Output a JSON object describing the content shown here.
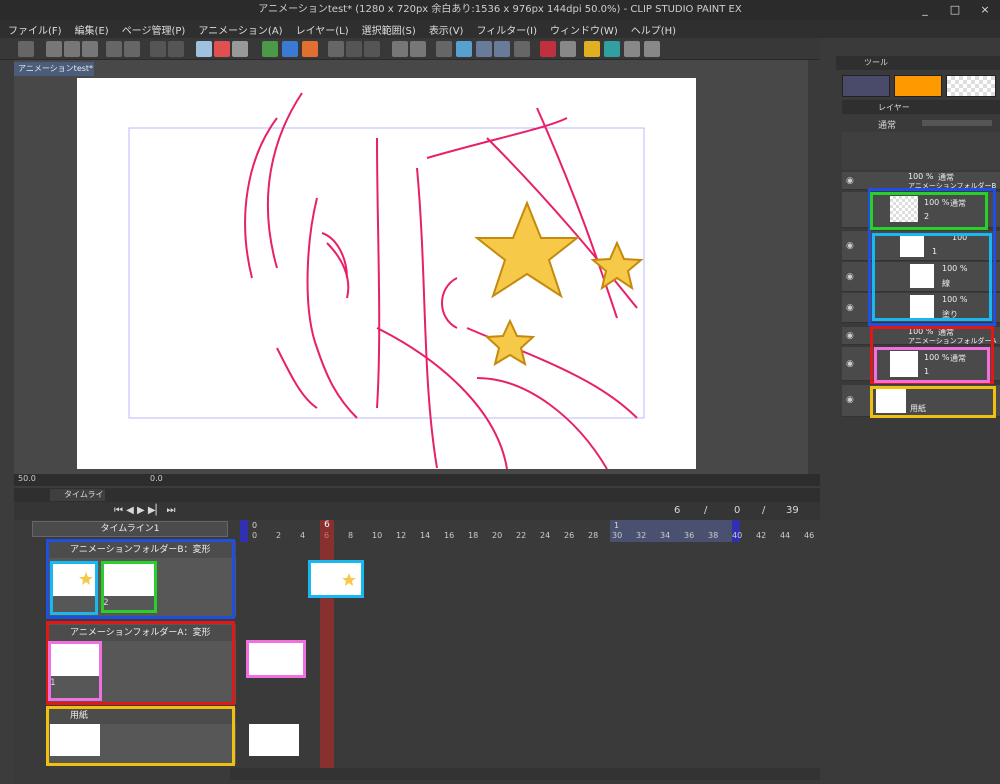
{
  "window": {
    "title": "アニメーションtest* (1280 x 720px 余白あり:1536 x 976px 144dpi 50.0%) - CLIP STUDIO PAINT EX",
    "controls": [
      "_",
      "□",
      "×"
    ]
  },
  "menu": [
    "ファイル(F)",
    "編集(E)",
    "ページ管理(P)",
    "アニメーション(A)",
    "レイヤー(L)",
    "選択範囲(S)",
    "表示(V)",
    "フィルター(I)",
    "ウィンドウ(W)",
    "ヘルプ(H)"
  ],
  "canvas": {
    "tab_label": "アニメーションtest*",
    "zoom": "50.0",
    "angle": "0.0"
  },
  "timeline": {
    "panel_tab": "タイムライン",
    "select_value": "タイムライン1",
    "frame_current": "6",
    "frame_sep1": "/",
    "frame_zero": "0",
    "frame_sep2": "/",
    "frame_total": "39",
    "ruler_labels": [
      "0",
      "2",
      "4",
      "6",
      "8",
      "10",
      "12",
      "14",
      "16",
      "18",
      "20",
      "22",
      "24",
      "26",
      "28",
      "30",
      "32",
      "34",
      "36",
      "38",
      "40",
      "42",
      "44",
      "46"
    ],
    "ruler_top_left": "0",
    "ruler_top_mid": "1",
    "playhead_label": "6",
    "tracks": [
      {
        "name": "アニメーションフォルダーB：変形",
        "cel_label": "2"
      },
      {
        "name": "アニメーションフォルダーA：変形",
        "cel_label": "1"
      },
      {
        "name": "用紙"
      }
    ]
  },
  "layers": {
    "tool_tab": "ツール",
    "layer_tab": "レイヤー",
    "blend_mode": "通常",
    "rows": [
      {
        "opacity": "100 %",
        "mode": "通常",
        "sub": "アニメーションフォルダーB"
      },
      {
        "opacity": "100 %",
        "mode": "通常",
        "sub": "2"
      },
      {
        "opacity": "100",
        "mode": "",
        "sub": "1"
      },
      {
        "opacity": "100 %",
        "mode": "",
        "sub": "線"
      },
      {
        "opacity": "100 %",
        "mode": "",
        "sub": "塗り"
      },
      {
        "opacity": "100 %",
        "mode": "通常",
        "sub": "アニメーションフォルダーA"
      },
      {
        "opacity": "100 %",
        "mode": "通常",
        "sub": "1"
      },
      {
        "opacity": "",
        "mode": "",
        "sub": "用紙"
      }
    ]
  },
  "colors": {
    "highlight_blue": "#1f4fe0",
    "highlight_green": "#2bcf2b",
    "highlight_cyan": "#1ab8f0",
    "highlight_red": "#e01818",
    "highlight_pink": "#f070e0",
    "highlight_yellow": "#f0c010",
    "sketch": "#e8206a",
    "star": "#f7c948",
    "swatch_main": "#4a4a6a",
    "swatch_sub": "#ff9900"
  }
}
